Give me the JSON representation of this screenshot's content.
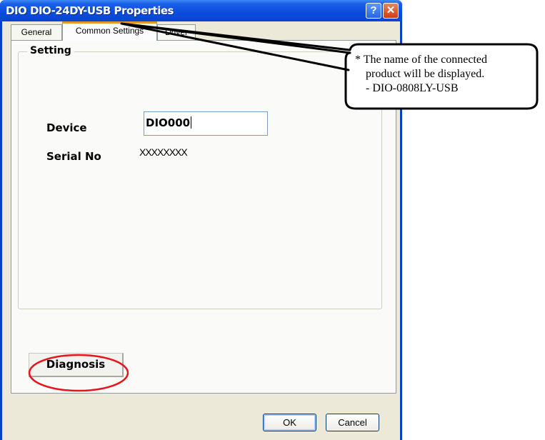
{
  "window": {
    "title": "DIO DIO-24DY-USB Properties",
    "help_label": "?",
    "close_label": "✕"
  },
  "tabs": [
    {
      "label": "General"
    },
    {
      "label": "Common Settings",
      "active": true
    },
    {
      "label": "Driver"
    }
  ],
  "setting": {
    "group_label": "Setting",
    "device_label": "Device",
    "device_value": "DIO000",
    "serial_label": "Serial No",
    "serial_value": "XXXXXXXX"
  },
  "diagnosis_label": "Diagnosis",
  "buttons": {
    "ok": "OK",
    "cancel": "Cancel"
  },
  "annotation": {
    "line1": "* The name of the connected",
    "line2": "product will be displayed.",
    "line3": "- DIO-0808LY-USB",
    "highlight_color": "#e8131b"
  },
  "colors": {
    "titlebar": "#0a4ddc",
    "dialog_bg": "#ece9d8",
    "active_tab_accent": "#e69a25"
  }
}
